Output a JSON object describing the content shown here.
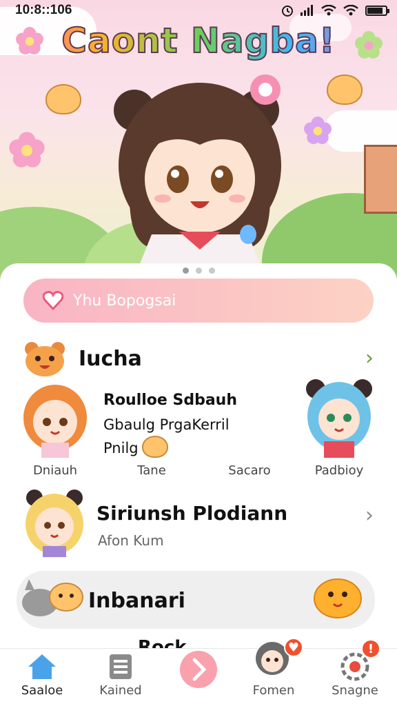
{
  "status_bar": {
    "time": "10:8::106"
  },
  "hero": {
    "title": "Caont Nagba!",
    "page_count": 3,
    "active_page": 0
  },
  "search": {
    "placeholder": "Yhu Bopogsai"
  },
  "section1": {
    "title": "Iucha",
    "featured": {
      "line1": "Roulloe Sdbauh",
      "line2": "Gbaulg PrgaKerril",
      "line3": "Pnilg"
    },
    "avatars": [
      {
        "label": "Dniauh"
      },
      {
        "label": "Tane"
      },
      {
        "label": "Sacaro"
      },
      {
        "label": "Padbioy"
      }
    ]
  },
  "section2": {
    "title": "Siriunsh Plodiann",
    "subtitle": "Afon Kum"
  },
  "section3": {
    "title": "Inbanari",
    "peek": "Rock"
  },
  "nav": {
    "items": [
      {
        "label": "Saaloe",
        "icon": "home-icon"
      },
      {
        "label": "Kained",
        "icon": "list-icon"
      },
      {
        "label": "",
        "icon": "chevron-right-icon"
      },
      {
        "label": "Fomen",
        "icon": "avatar-icon"
      },
      {
        "label": "Snagne",
        "icon": "settings-icon"
      }
    ],
    "badges": [
      "",
      "!"
    ]
  },
  "colors": {
    "accent": "#f9b4c4",
    "chevron": "#6c9a3c",
    "badge": "#f0502e",
    "home": "#4aa3e8"
  }
}
